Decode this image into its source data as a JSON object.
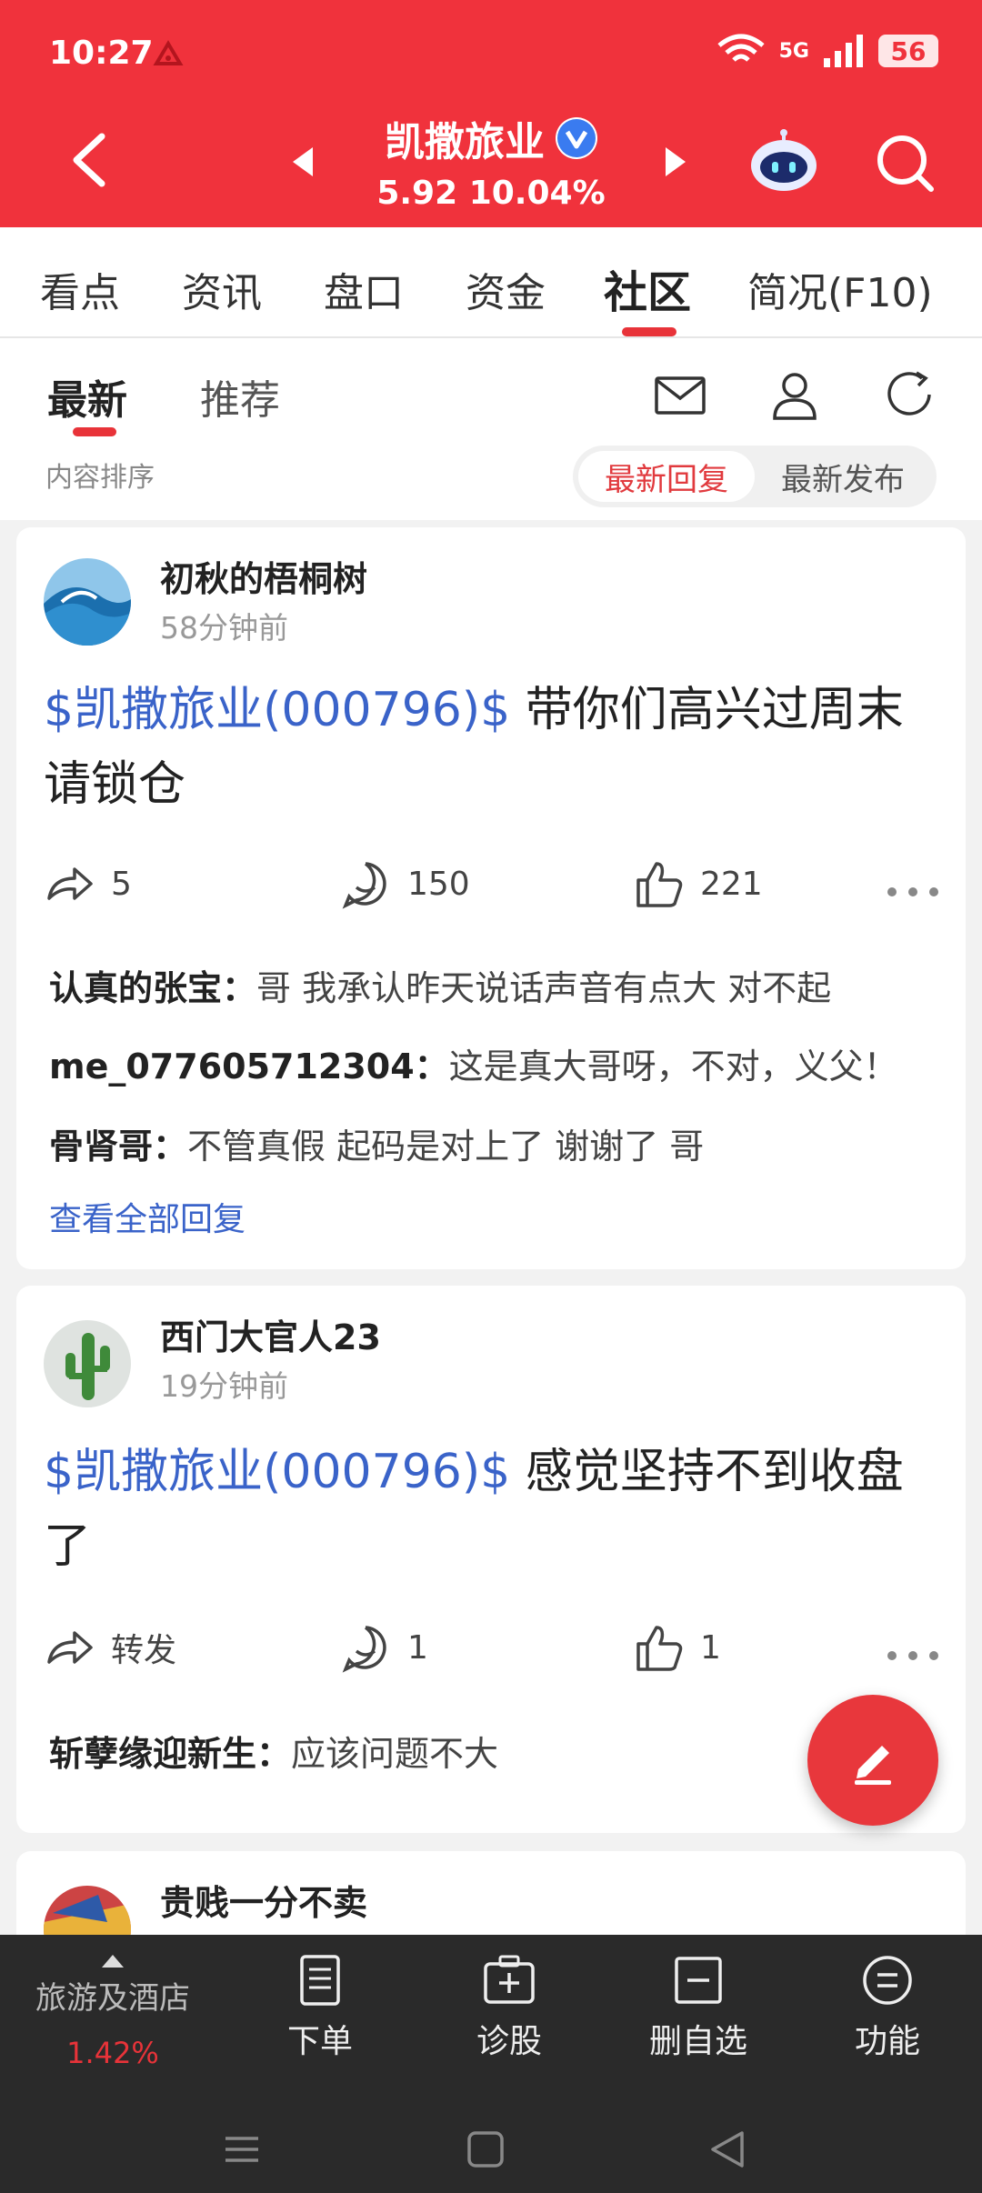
{
  "status": {
    "time": "10:27",
    "network": "5G",
    "battery": "56"
  },
  "header": {
    "stock_name": "凯撒旅业",
    "price": "5.92",
    "change_pct": "10.04%"
  },
  "tabs": [
    "看点",
    "资讯",
    "盘口",
    "资金",
    "社区",
    "简况(F10)"
  ],
  "active_tab": "社区",
  "subtabs": [
    "最新",
    "推荐"
  ],
  "sort": {
    "label": "内容排序",
    "options": [
      "最新回复",
      "最新发布"
    ],
    "active": "最新回复"
  },
  "posts": [
    {
      "user": "初秋的梧桐树",
      "time": "58分钟前",
      "tag": "$凯撒旅业(000796)$",
      "text": " 带你们高兴过周末请锁仓",
      "forward": "5",
      "comments": "150",
      "likes": "221",
      "replies": [
        {
          "user": "认真的张宝：",
          "text": "哥 我承认昨天说话声音有点大 对不起"
        },
        {
          "user": "me_077605712304：",
          "text": "这是真大哥呀，不对，义父！"
        },
        {
          "user": "骨肾哥：",
          "text": "不管真假 起码是对上了 谢谢了 哥"
        }
      ],
      "view_all": "查看全部回复"
    },
    {
      "user": "西门大官人23",
      "time": "19分钟前",
      "tag": "$凯撒旅业(000796)$",
      "text": " 感觉坚持不到收盘了",
      "forward": "转发",
      "comments": "1",
      "likes": "1",
      "replies": [
        {
          "user": "斩孽缘迎新生：",
          "text": "应该问题不大"
        }
      ]
    },
    {
      "user": "贵贱一分不卖"
    }
  ],
  "bottom": {
    "sector_name": "旅游及酒店",
    "sector_change": "1.42%",
    "items": [
      "下单",
      "诊股",
      "删自选",
      "功能"
    ]
  },
  "colors": {
    "brand_red": "#f0323c",
    "link_blue": "#3a63c9"
  }
}
